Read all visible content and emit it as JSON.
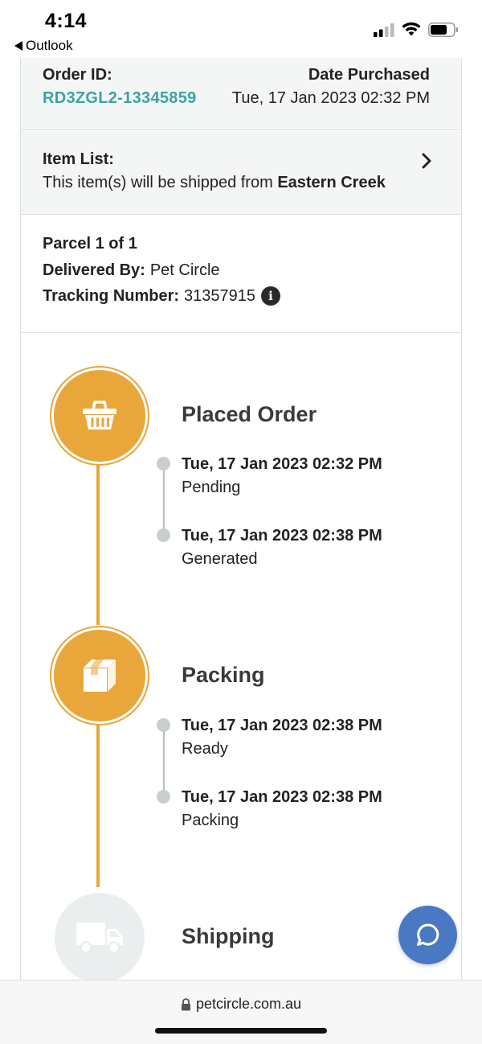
{
  "status_bar": {
    "time": "4:14",
    "back_app": "Outlook"
  },
  "order": {
    "id_label": "Order ID:",
    "id_value": "RD3ZGL2-13345859",
    "date_label": "Date Purchased",
    "date_value": "Tue, 17 Jan 2023 02:32 PM"
  },
  "items": {
    "label": "Item List:",
    "ship_prefix": "This item(s) will be shipped from ",
    "ship_location": "Eastern Creek"
  },
  "parcel": {
    "title": "Parcel 1 of 1",
    "delivered_label": "Delivered By:",
    "delivered_value": "Pet Circle",
    "tracking_label": "Tracking Number:",
    "tracking_value": "31357915"
  },
  "timeline": {
    "stages": [
      {
        "title": "Placed Order",
        "icon": "basket-icon",
        "events": [
          {
            "date": "Tue, 17 Jan 2023 02:32 PM",
            "status": "Pending"
          },
          {
            "date": "Tue, 17 Jan 2023 02:38 PM",
            "status": "Generated"
          }
        ]
      },
      {
        "title": "Packing",
        "icon": "box-icon",
        "events": [
          {
            "date": "Tue, 17 Jan 2023 02:38 PM",
            "status": "Ready"
          },
          {
            "date": "Tue, 17 Jan 2023 02:38 PM",
            "status": "Packing"
          }
        ]
      },
      {
        "title": "Shipping",
        "icon": "truck-icon",
        "events": []
      }
    ]
  },
  "browser": {
    "url": "petcircle.com.au"
  },
  "colors": {
    "accent_orange": "#e8a63b",
    "teal_link": "#3aa4a0",
    "chat_blue": "#4a79c4",
    "inactive_gray": "#ebeeef"
  }
}
